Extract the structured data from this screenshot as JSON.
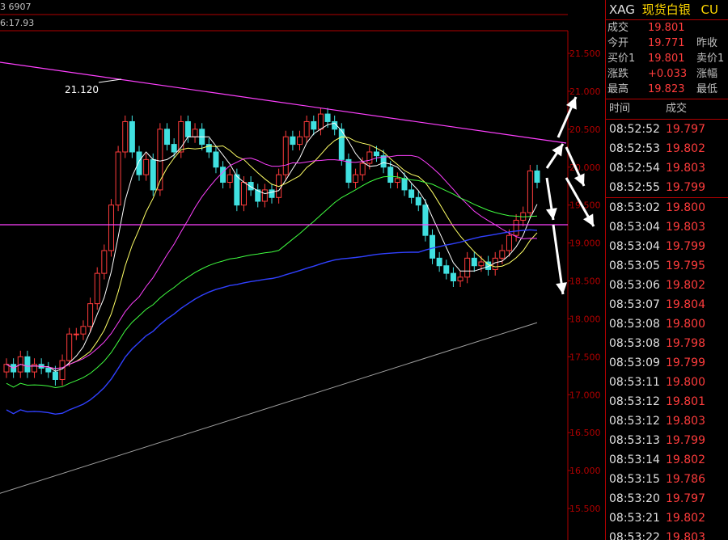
{
  "chart": {
    "corner_top": "3 6907",
    "corner_sub": "6:17.93",
    "y_ticks": [
      "21.500",
      "21.000",
      "20.500",
      "20.000",
      "19.500",
      "19.000",
      "18.500",
      "18.000",
      "17.500",
      "17.000",
      "16.500",
      "16.000",
      "15.500"
    ],
    "y_range": [
      15.3,
      21.7
    ],
    "high_label": "21.120",
    "colors": {
      "up": "#ff3c3c",
      "down": "#40e0e0",
      "ma5": "#ffffff",
      "ma10": "#ffff66",
      "ma20": "#ff40ff",
      "ma40": "#40ff40",
      "ma60": "#3040ff",
      "ma120": "#a0a0a0",
      "trend": "#ff40ff",
      "axis": "#b00000",
      "arrows": "#ffffff"
    }
  },
  "panel": {
    "symbol": "XAG",
    "name": "现货白银",
    "suffix": "CU",
    "quote": [
      {
        "label": "成交",
        "value": "19.801",
        "label2": ""
      },
      {
        "label": "今开",
        "value": "19.771",
        "label2": "昨收"
      },
      {
        "label": "买价1",
        "value": "19.801",
        "label2": "卖价1"
      },
      {
        "label": "涨跌",
        "value": "+0.033",
        "label2": "涨幅"
      },
      {
        "label": "最高",
        "value": "19.823",
        "label2": "最低"
      }
    ],
    "tick_header": {
      "time": "时间",
      "price": "成交"
    },
    "ticks": [
      {
        "time": "08:52:52",
        "price": "19.797"
      },
      {
        "time": "08:52:53",
        "price": "19.802"
      },
      {
        "time": "08:52:54",
        "price": "19.803"
      },
      {
        "time": "08:52:55",
        "price": "19.799"
      },
      {
        "time": "08:53:02",
        "price": "19.800"
      },
      {
        "time": "08:53:04",
        "price": "19.803"
      },
      {
        "time": "08:53:04",
        "price": "19.799"
      },
      {
        "time": "08:53:05",
        "price": "19.795"
      },
      {
        "time": "08:53:06",
        "price": "19.802"
      },
      {
        "time": "08:53:07",
        "price": "19.804"
      },
      {
        "time": "08:53:08",
        "price": "19.800"
      },
      {
        "time": "08:53:08",
        "price": "19.798"
      },
      {
        "time": "08:53:09",
        "price": "19.799"
      },
      {
        "time": "08:53:11",
        "price": "19.800"
      },
      {
        "time": "08:53:12",
        "price": "19.801"
      },
      {
        "time": "08:53:12",
        "price": "19.803"
      },
      {
        "time": "08:53:13",
        "price": "19.799"
      },
      {
        "time": "08:53:14",
        "price": "19.802"
      },
      {
        "time": "08:53:15",
        "price": "19.786"
      },
      {
        "time": "08:53:20",
        "price": "19.797"
      },
      {
        "time": "08:53:21",
        "price": "19.802"
      },
      {
        "time": "08:53:22",
        "price": "19.803"
      }
    ]
  }
}
